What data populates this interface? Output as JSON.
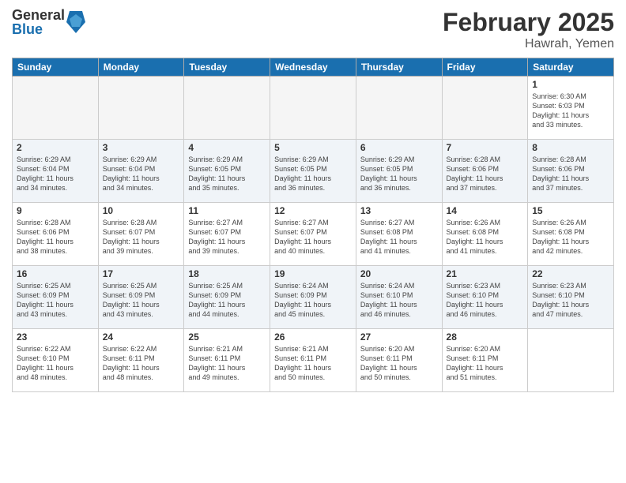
{
  "logo": {
    "general": "General",
    "blue": "Blue"
  },
  "title": "February 2025",
  "location": "Hawrah, Yemen",
  "weekdays": [
    "Sunday",
    "Monday",
    "Tuesday",
    "Wednesday",
    "Thursday",
    "Friday",
    "Saturday"
  ],
  "weeks": [
    [
      {
        "day": "",
        "info": ""
      },
      {
        "day": "",
        "info": ""
      },
      {
        "day": "",
        "info": ""
      },
      {
        "day": "",
        "info": ""
      },
      {
        "day": "",
        "info": ""
      },
      {
        "day": "",
        "info": ""
      },
      {
        "day": "1",
        "info": "Sunrise: 6:30 AM\nSunset: 6:03 PM\nDaylight: 11 hours\nand 33 minutes."
      }
    ],
    [
      {
        "day": "2",
        "info": "Sunrise: 6:29 AM\nSunset: 6:04 PM\nDaylight: 11 hours\nand 34 minutes."
      },
      {
        "day": "3",
        "info": "Sunrise: 6:29 AM\nSunset: 6:04 PM\nDaylight: 11 hours\nand 34 minutes."
      },
      {
        "day": "4",
        "info": "Sunrise: 6:29 AM\nSunset: 6:05 PM\nDaylight: 11 hours\nand 35 minutes."
      },
      {
        "day": "5",
        "info": "Sunrise: 6:29 AM\nSunset: 6:05 PM\nDaylight: 11 hours\nand 36 minutes."
      },
      {
        "day": "6",
        "info": "Sunrise: 6:29 AM\nSunset: 6:05 PM\nDaylight: 11 hours\nand 36 minutes."
      },
      {
        "day": "7",
        "info": "Sunrise: 6:28 AM\nSunset: 6:06 PM\nDaylight: 11 hours\nand 37 minutes."
      },
      {
        "day": "8",
        "info": "Sunrise: 6:28 AM\nSunset: 6:06 PM\nDaylight: 11 hours\nand 37 minutes."
      }
    ],
    [
      {
        "day": "9",
        "info": "Sunrise: 6:28 AM\nSunset: 6:06 PM\nDaylight: 11 hours\nand 38 minutes."
      },
      {
        "day": "10",
        "info": "Sunrise: 6:28 AM\nSunset: 6:07 PM\nDaylight: 11 hours\nand 39 minutes."
      },
      {
        "day": "11",
        "info": "Sunrise: 6:27 AM\nSunset: 6:07 PM\nDaylight: 11 hours\nand 39 minutes."
      },
      {
        "day": "12",
        "info": "Sunrise: 6:27 AM\nSunset: 6:07 PM\nDaylight: 11 hours\nand 40 minutes."
      },
      {
        "day": "13",
        "info": "Sunrise: 6:27 AM\nSunset: 6:08 PM\nDaylight: 11 hours\nand 41 minutes."
      },
      {
        "day": "14",
        "info": "Sunrise: 6:26 AM\nSunset: 6:08 PM\nDaylight: 11 hours\nand 41 minutes."
      },
      {
        "day": "15",
        "info": "Sunrise: 6:26 AM\nSunset: 6:08 PM\nDaylight: 11 hours\nand 42 minutes."
      }
    ],
    [
      {
        "day": "16",
        "info": "Sunrise: 6:25 AM\nSunset: 6:09 PM\nDaylight: 11 hours\nand 43 minutes."
      },
      {
        "day": "17",
        "info": "Sunrise: 6:25 AM\nSunset: 6:09 PM\nDaylight: 11 hours\nand 43 minutes."
      },
      {
        "day": "18",
        "info": "Sunrise: 6:25 AM\nSunset: 6:09 PM\nDaylight: 11 hours\nand 44 minutes."
      },
      {
        "day": "19",
        "info": "Sunrise: 6:24 AM\nSunset: 6:09 PM\nDaylight: 11 hours\nand 45 minutes."
      },
      {
        "day": "20",
        "info": "Sunrise: 6:24 AM\nSunset: 6:10 PM\nDaylight: 11 hours\nand 46 minutes."
      },
      {
        "day": "21",
        "info": "Sunrise: 6:23 AM\nSunset: 6:10 PM\nDaylight: 11 hours\nand 46 minutes."
      },
      {
        "day": "22",
        "info": "Sunrise: 6:23 AM\nSunset: 6:10 PM\nDaylight: 11 hours\nand 47 minutes."
      }
    ],
    [
      {
        "day": "23",
        "info": "Sunrise: 6:22 AM\nSunset: 6:10 PM\nDaylight: 11 hours\nand 48 minutes."
      },
      {
        "day": "24",
        "info": "Sunrise: 6:22 AM\nSunset: 6:11 PM\nDaylight: 11 hours\nand 48 minutes."
      },
      {
        "day": "25",
        "info": "Sunrise: 6:21 AM\nSunset: 6:11 PM\nDaylight: 11 hours\nand 49 minutes."
      },
      {
        "day": "26",
        "info": "Sunrise: 6:21 AM\nSunset: 6:11 PM\nDaylight: 11 hours\nand 50 minutes."
      },
      {
        "day": "27",
        "info": "Sunrise: 6:20 AM\nSunset: 6:11 PM\nDaylight: 11 hours\nand 50 minutes."
      },
      {
        "day": "28",
        "info": "Sunrise: 6:20 AM\nSunset: 6:11 PM\nDaylight: 11 hours\nand 51 minutes."
      },
      {
        "day": "",
        "info": ""
      }
    ]
  ]
}
